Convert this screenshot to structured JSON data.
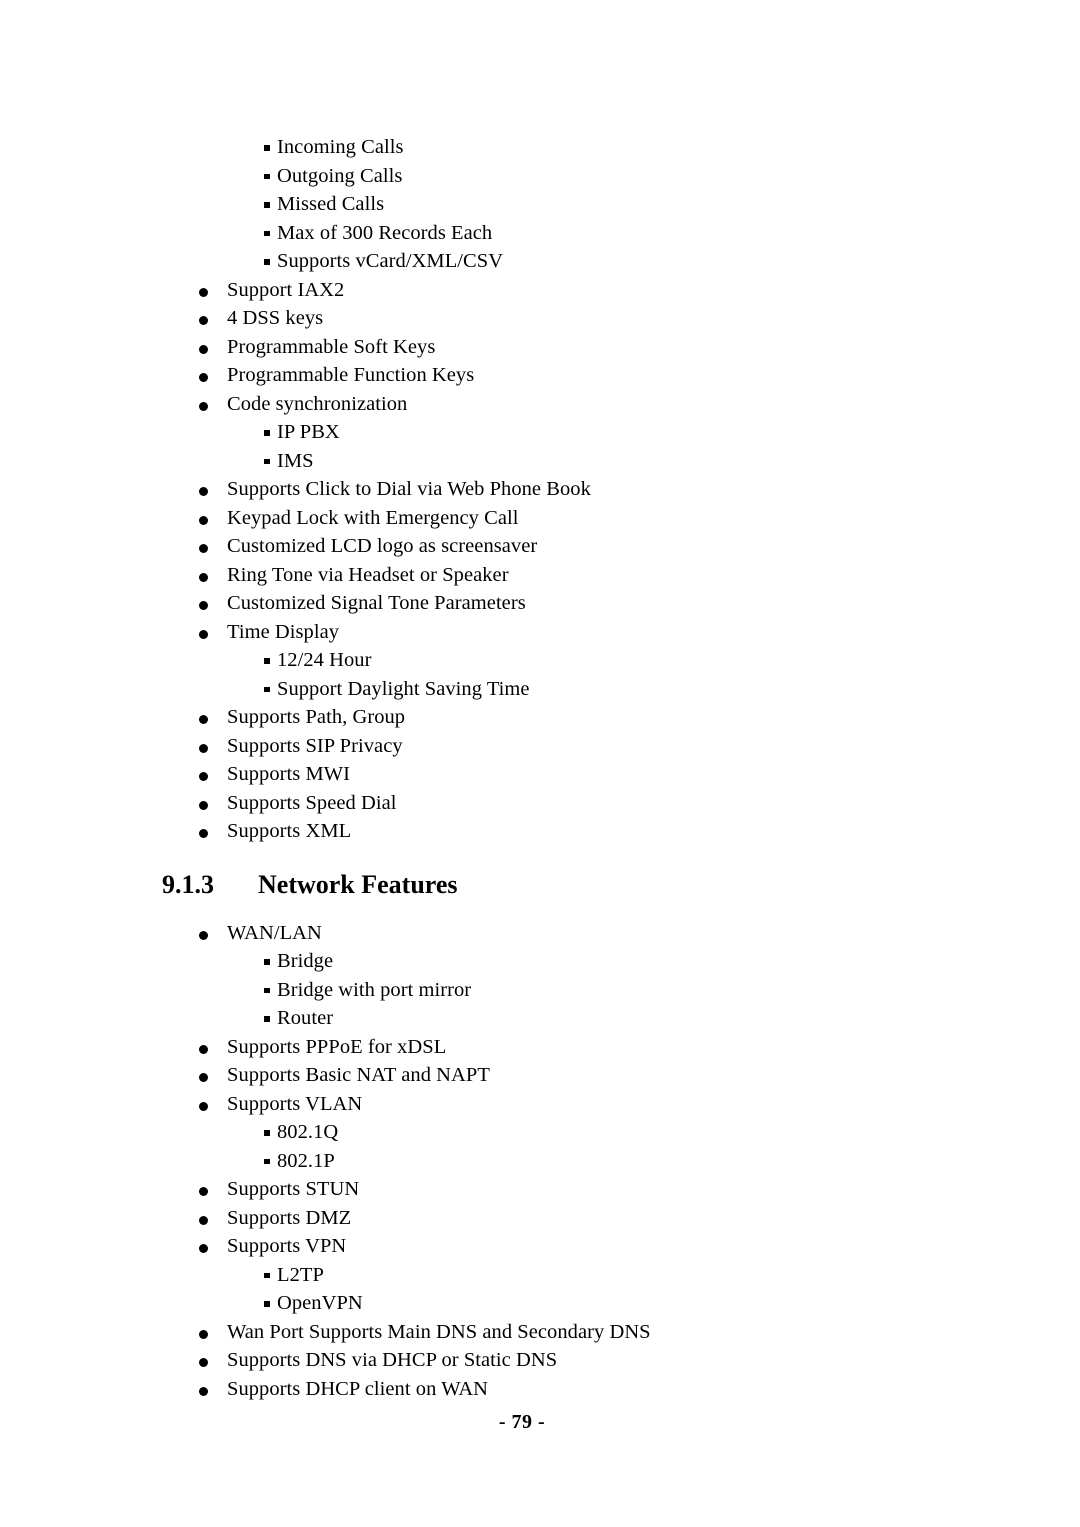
{
  "document": {
    "page_number_label": "- 79 -"
  },
  "section_continued": {
    "items": [
      {
        "level": 2,
        "text": "Incoming Calls"
      },
      {
        "level": 2,
        "text": "Outgoing Calls"
      },
      {
        "level": 2,
        "text": "Missed Calls"
      },
      {
        "level": 2,
        "text": "Max of 300 Records Each"
      },
      {
        "level": 2,
        "text": "Supports vCard/XML/CSV"
      },
      {
        "level": 1,
        "text": "Support IAX2"
      },
      {
        "level": 1,
        "text": "4 DSS keys"
      },
      {
        "level": 1,
        "text": "Programmable Soft Keys"
      },
      {
        "level": 1,
        "text": "Programmable Function Keys"
      },
      {
        "level": 1,
        "text": "Code synchronization"
      },
      {
        "level": 2,
        "text": "IP PBX"
      },
      {
        "level": 2,
        "text": "IMS"
      },
      {
        "level": 1,
        "text": "Supports Click to Dial via Web Phone Book"
      },
      {
        "level": 1,
        "text": "Keypad Lock with Emergency Call"
      },
      {
        "level": 1,
        "text": "Customized LCD logo as screensaver"
      },
      {
        "level": 1,
        "text": "Ring Tone via Headset or Speaker"
      },
      {
        "level": 1,
        "text": "Customized Signal Tone Parameters"
      },
      {
        "level": 1,
        "text": "Time Display"
      },
      {
        "level": 2,
        "text": "12/24 Hour"
      },
      {
        "level": 2,
        "text": "Support Daylight Saving Time"
      },
      {
        "level": 1,
        "text": "Supports Path, Group"
      },
      {
        "level": 1,
        "text": "Supports SIP Privacy"
      },
      {
        "level": 1,
        "text": "Supports MWI"
      },
      {
        "level": 1,
        "text": "Supports Speed Dial"
      },
      {
        "level": 1,
        "text": "Supports XML"
      }
    ]
  },
  "section_network": {
    "number": "9.1.3",
    "title": "Network Features",
    "items": [
      {
        "level": 1,
        "text": "WAN/LAN"
      },
      {
        "level": 2,
        "text": "Bridge"
      },
      {
        "level": 2,
        "text": "Bridge with port mirror"
      },
      {
        "level": 2,
        "text": "Router"
      },
      {
        "level": 1,
        "text": "Supports PPPoE for xDSL"
      },
      {
        "level": 1,
        "text": "Supports Basic NAT and NAPT"
      },
      {
        "level": 1,
        "text": "Supports VLAN"
      },
      {
        "level": 2,
        "text": "802.1Q"
      },
      {
        "level": 2,
        "text": "802.1P"
      },
      {
        "level": 1,
        "text": "Supports STUN"
      },
      {
        "level": 1,
        "text": "Supports DMZ"
      },
      {
        "level": 1,
        "text": "Supports VPN"
      },
      {
        "level": 2,
        "text": "L2TP"
      },
      {
        "level": 2,
        "text": "OpenVPN"
      },
      {
        "level": 1,
        "text": "Wan Port Supports Main DNS and Secondary DNS"
      },
      {
        "level": 1,
        "text": "Supports DNS via DHCP or Static DNS"
      },
      {
        "level": 1,
        "text": "Supports DHCP client on WAN"
      }
    ]
  }
}
